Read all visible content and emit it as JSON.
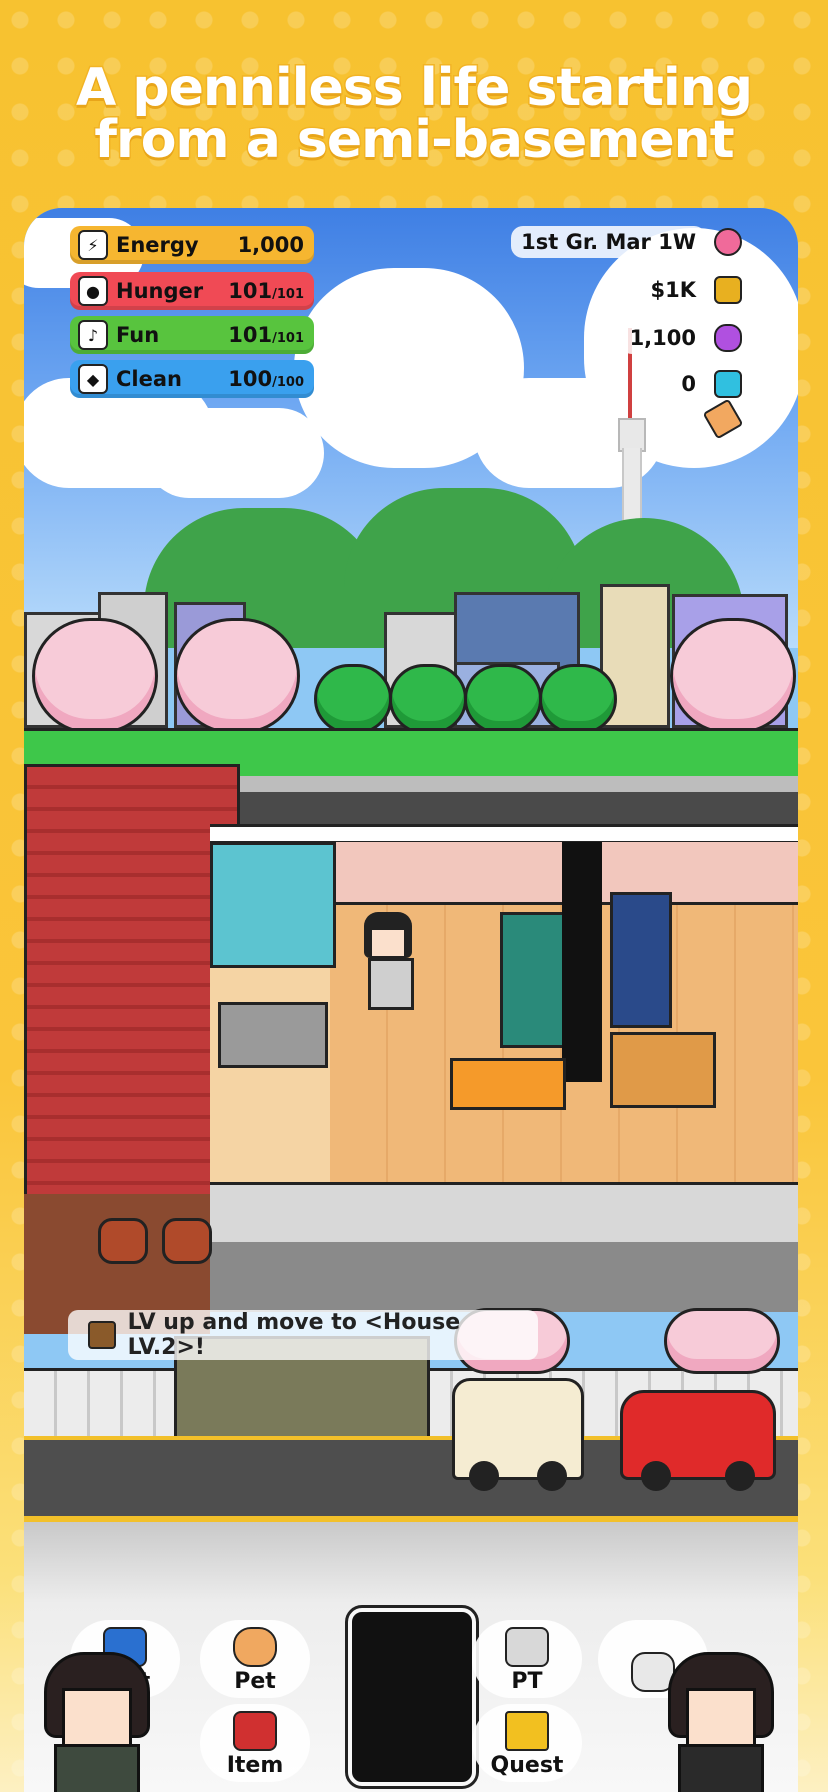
{
  "headline": {
    "line1": "A penniless life starting",
    "line2": "from a semi-basement"
  },
  "stats": {
    "energy": {
      "label": "Energy",
      "value": "1,000",
      "color": "#f6b630",
      "icon": "lightning-icon"
    },
    "hunger": {
      "label": "Hunger",
      "value": "101",
      "max": "/101",
      "color": "#f04a55",
      "icon": "apple-icon"
    },
    "fun": {
      "label": "Fun",
      "value": "101",
      "max": "/101",
      "color": "#58c43e",
      "icon": "music-note-icon"
    },
    "clean": {
      "label": "Clean",
      "value": "100",
      "max": "/100",
      "color": "#3aa0ee",
      "icon": "water-drop-icon"
    }
  },
  "resources": {
    "date": "1st Gr. Mar 1W",
    "money": "$1K",
    "gems": "1,100",
    "crystals": "0"
  },
  "quest_banner": "LV up and move to <House LV.2>!",
  "menu": {
    "outfit_partial": "t",
    "pet": "Pet",
    "item": "Item",
    "pt": "PT",
    "quest": "Quest"
  }
}
